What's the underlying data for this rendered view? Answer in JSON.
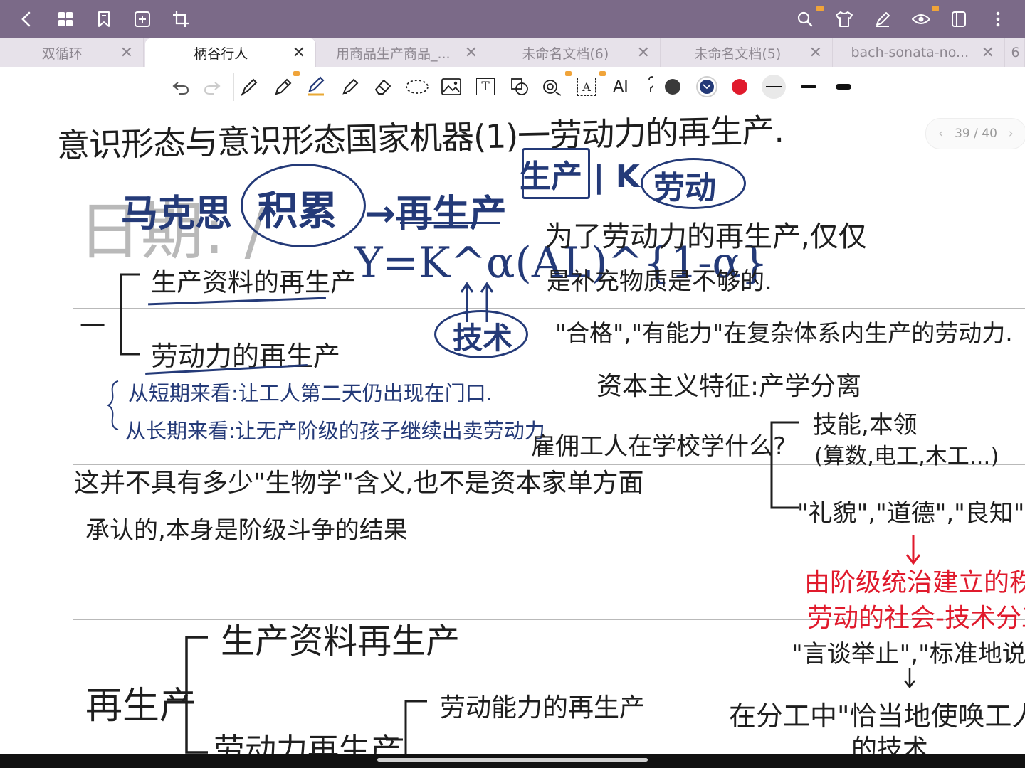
{
  "app": {
    "topbar_icons": [
      "back-chevron-icon",
      "grid-icon",
      "bookmark-icon",
      "add-page-icon",
      "crop-icon",
      "search-icon",
      "shirt-icon",
      "pen-icon",
      "eye-icon",
      "page-panel-icon",
      "more-vertical-icon"
    ]
  },
  "tabs": [
    {
      "label": "双循环",
      "close": "✕"
    },
    {
      "label": "柄谷行人",
      "close": "✕"
    },
    {
      "label": "用商品生产商品_...",
      "close": "✕"
    },
    {
      "label": "未命名文档(6)",
      "close": "✕"
    },
    {
      "label": "未命名文档(5)",
      "close": "✕"
    },
    {
      "label": "bach-sonata-no...",
      "close": "✕"
    },
    {
      "label": "6"
    }
  ],
  "toolbar": {
    "text_tool_glyph": "T",
    "ocr_glyph": "A",
    "ai_label": "AI",
    "colors": {
      "dark_gray": "#3a3a3a",
      "navy": "#243a78",
      "red": "#e01a2c"
    },
    "strokes": [
      "thin",
      "medium",
      "thick"
    ]
  },
  "pager": {
    "label": "39 / 40"
  },
  "watermark": {
    "text": "日期:  /"
  },
  "notes": {
    "title": "意识形态与意识形态国家机器(1)一劳动力的再生产.",
    "blue_top": [
      "马克思",
      "积累",
      "→再生产",
      "生产 | K",
      "劳动"
    ],
    "formula": "Y=K^α(AL)^{1-α}",
    "tech": "技术",
    "branch1": "生产资料的再生产",
    "branch2": "劳动力的再生产",
    "dash": "一",
    "short_term": "从短期来看:让工人第二天仍出现在门口.",
    "long_term": "从长期来看:让无产阶级的孩子继续出卖劳动力",
    "right1": "为了劳动力的再生产,仅仅",
    "right2": "是补充物质是不够的.",
    "right3": "\"合格\",\"有能力\"在复杂体系内生产的劳动力.",
    "right4": "资本主义特征:产学分离",
    "right5": "雇佣工人在学校学什么?",
    "right6": "技能,本领",
    "right7": "(算数,电工,木工...)",
    "right8": "\"礼貌\",\"道德\",\"良知\"",
    "mid1": "这并不具有多少\"生物学\"含义,也不是资本家单方面",
    "mid2": "承认的,本身是阶级斗争的结果",
    "red1": "由阶级统治建立的秩序",
    "red2": "劳动的社会-技术分工",
    "quote": "\"言谈举止\",\"标准地说\"",
    "bottom_right1": "在分工中\"恰当地使唤工人\"",
    "bottom_right2": "的技术",
    "bottom_root": "再生产",
    "bottom_b1": "生产资料再生产",
    "bottom_b2": "劳动力再生产",
    "bottom_b3": "劳动能力的再生产"
  }
}
